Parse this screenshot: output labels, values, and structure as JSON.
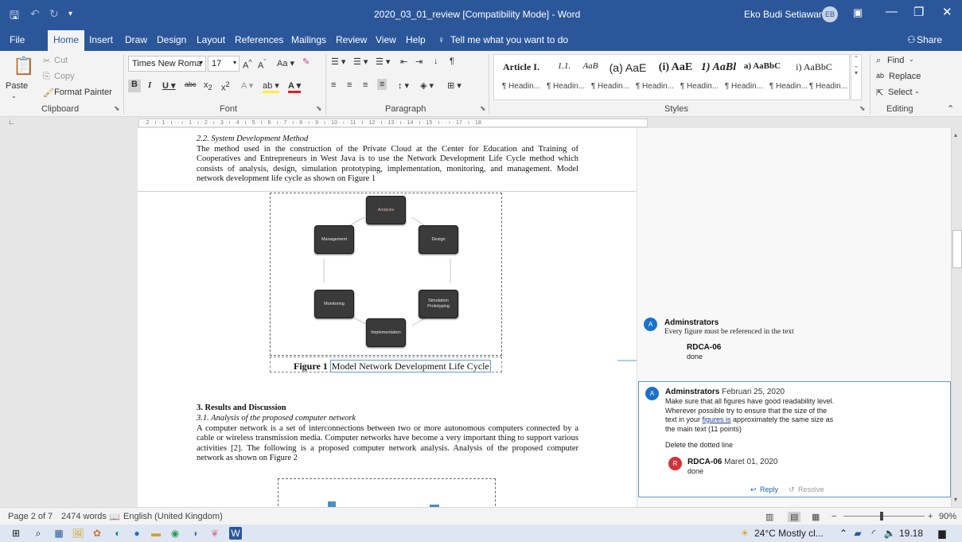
{
  "titlebar": {
    "doc_title": "2020_03_01_review [Compatibility Mode]  -  Word",
    "user_name": "Eko Budi Setiawan",
    "user_initials": "EB"
  },
  "tabs": [
    "File",
    "Home",
    "Insert",
    "Draw",
    "Design",
    "Layout",
    "References",
    "Mailings",
    "Review",
    "View",
    "Help"
  ],
  "tell_me": "Tell me what you want to do",
  "share": "Share",
  "ribbon": {
    "clipboard": {
      "paste": "Paste",
      "cut": "Cut",
      "copy": "Copy",
      "format_painter": "Format Painter",
      "label": "Clipboard"
    },
    "font": {
      "name": "Times New Roma",
      "size": "17",
      "label": "Font"
    },
    "paragraph": {
      "label": "Paragraph"
    },
    "styles": {
      "label": "Styles",
      "items": [
        {
          "sample": "Article I.",
          "name": "¶ Headin..."
        },
        {
          "sample": "1.1.",
          "name": "¶ Headin..."
        },
        {
          "sample": "AaB",
          "name": "¶ Headin..."
        },
        {
          "sample": "(a) AaE",
          "name": "¶ Headin..."
        },
        {
          "sample": "(i) AaE",
          "name": "¶ Headin..."
        },
        {
          "sample": "1) AaBl",
          "name": "¶ Headin..."
        },
        {
          "sample": "a) AaBbC",
          "name": "¶ Headin..."
        },
        {
          "sample": "i) AaBbC",
          "name": "¶ Headin..."
        }
      ]
    },
    "editing": {
      "find": "Find",
      "replace": "Replace",
      "select": "Select",
      "label": "Editing"
    }
  },
  "ruler_text": "· 2 · ı · 1 · ı ·   · ı · 1 · ı · 2 · ı · 3 · ı · 4 · ı · 5 · ı · 6 · ı · 7 · ı · 8 · ı · 9 · ı · 10 · ı · 11 · ı · 12 · ı · 13 · ı · 14 · ı · 15 · ı ·   · ı · 17 · ı · 18 ·",
  "document": {
    "section_2_2_heading": "2.2.  System Development Method",
    "section_2_2_body": "The method used in the construction of the Private Cloud at the Center for Education and Training of Cooperatives and Entrepreneurs in West Java is to use the Network Development Life Cycle method which consists of analysis, design, simulation prototyping, implementation, monitoring, and management. Model network development life cycle as shown on Figure 1",
    "figure_nodes": {
      "analysis": "Analysis",
      "design": "Design",
      "simulation": "Simulation Prototyping",
      "implementation": "Implementation",
      "monitoring": "Monitoring",
      "management": "Management"
    },
    "figure1_label": "Figure 1",
    "figure1_caption": "Model Network Development Life Cycle",
    "section_3_heading": "3.  Results and Discussion",
    "section_3_1_heading": "3.1.  Analysis of the proposed computer network",
    "section_3_1_body": "A computer network is a set of interconnections between two or more autonomous computers connected by a cable or wireless transmission media. Computer networks have become a very important thing to support various activities [2]. The following is a proposed computer network analysis. Analysis of the proposed computer network as shown on Figure 2"
  },
  "comments": [
    {
      "initial": "A",
      "author": "Adminstrators",
      "text": "Every figure must be referenced in the text",
      "reply_author": "RDCA-06",
      "reply_text": "done"
    },
    {
      "initial": "A",
      "author": "Adminstrators",
      "date": "Februari 25, 2020",
      "text_before": "Make sure that all figures have good readability level. Wherever possible try to ensure that the size of the text in your ",
      "text_link": "figures  is",
      "text_after": " approximately the same size as the main text (11 points)",
      "text2": "Delete the dotted line",
      "reply_initial": "R",
      "reply_author": "RDCA-06",
      "reply_date": "Maret 01, 2020",
      "reply_text": "done",
      "reply_button": "Reply",
      "resolve_button": "Resolve"
    }
  ],
  "statusbar": {
    "page": "Page 2 of 7",
    "words": "2474 words",
    "language": "English (United Kingdom)",
    "zoom": "90%"
  },
  "taskbar": {
    "weather": "24°C  Mostly cl...",
    "time": "19.18"
  },
  "colors": {
    "word_blue": "#2b579a",
    "comment_blue": "#1a73c8",
    "reply_red": "#d13438"
  }
}
